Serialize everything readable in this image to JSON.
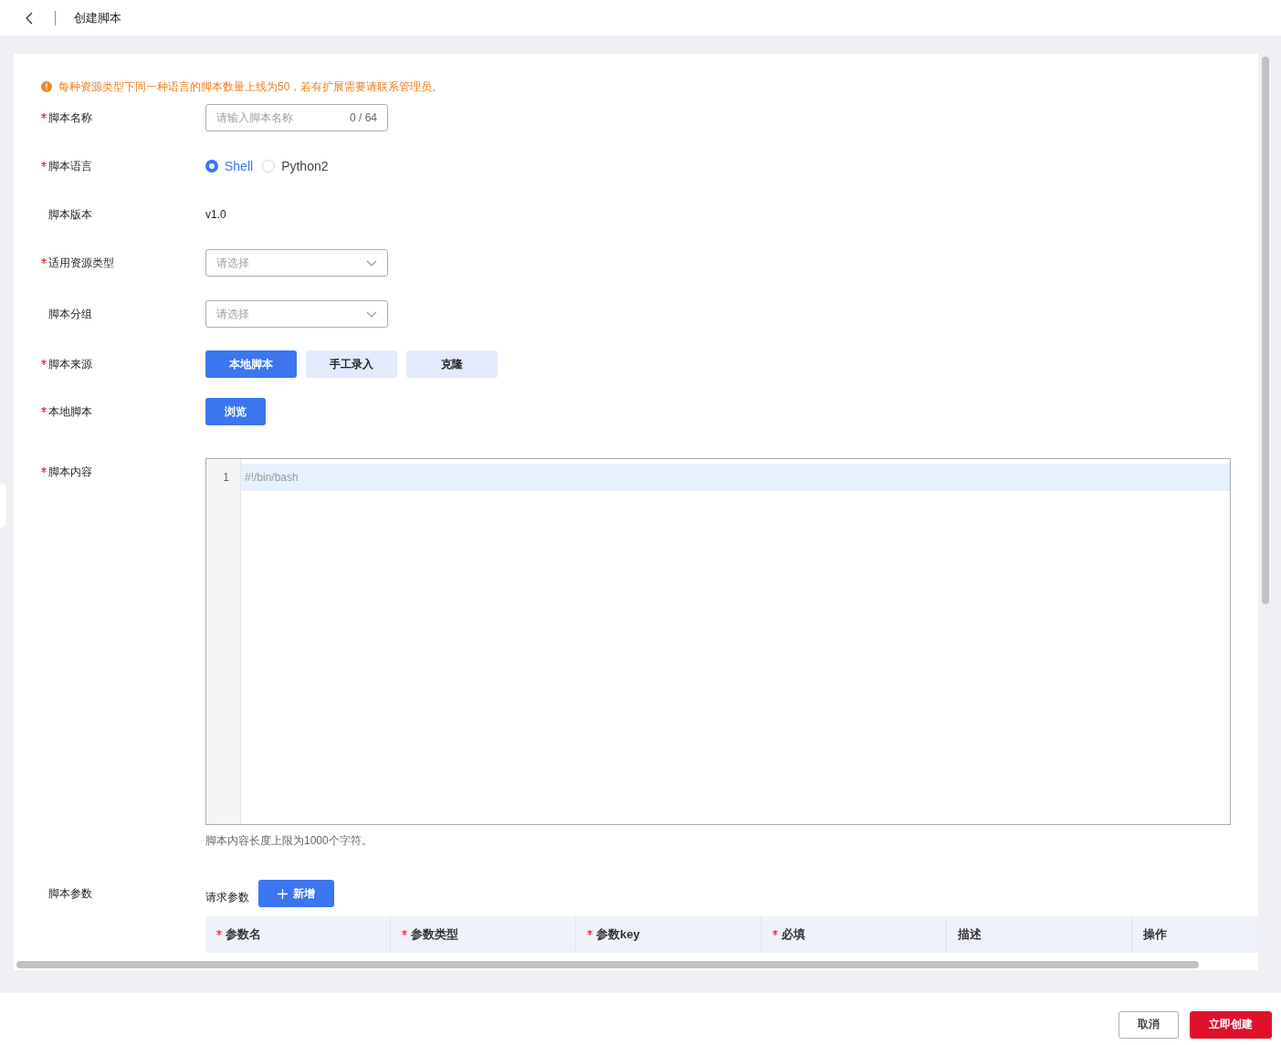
{
  "header": {
    "title": "创建脚本"
  },
  "notice": "每种资源类型下同一种语言的脚本数量上线为50，若有扩展需要请联系管理员。",
  "fields": [
    {
      "kind": "input",
      "label": "脚本名称",
      "required": true,
      "placeholder": "请输入脚本名称",
      "counter": "0 / 64"
    },
    {
      "kind": "radio",
      "label": "脚本语言",
      "required": true,
      "options": [
        {
          "label": "Shell",
          "selected": true
        },
        {
          "label": "Python2",
          "selected": false
        }
      ]
    },
    {
      "kind": "text",
      "label": "脚本版本",
      "required": false,
      "value": "v1.0"
    },
    {
      "kind": "select",
      "label": "适用资源类型",
      "required": true,
      "placeholder": "请选择"
    },
    {
      "kind": "select",
      "label": "脚本分组",
      "required": false,
      "placeholder": "请选择"
    },
    {
      "kind": "segmented",
      "label": "脚本来源",
      "required": true,
      "options": [
        {
          "label": "本地脚本",
          "selected": true
        },
        {
          "label": "手工录入",
          "selected": false
        },
        {
          "label": "克隆",
          "selected": false
        }
      ]
    },
    {
      "kind": "button",
      "label": "本地脚本",
      "required": true,
      "button": "浏览"
    },
    {
      "kind": "editor",
      "label": "脚本内容",
      "required": true,
      "lines": [
        {
          "number": "1",
          "text": "#!/bin/bash",
          "selected": true
        }
      ],
      "hint": "脚本内容长度上限为1000个字符。"
    },
    {
      "kind": "params",
      "label": "脚本参数",
      "required": false,
      "sublabel": "请求参数",
      "add_button": "新增",
      "columns": [
        {
          "label": "参数名",
          "required": true
        },
        {
          "label": "参数类型",
          "required": true
        },
        {
          "label": "参数key",
          "required": true
        },
        {
          "label": "必填",
          "required": true
        },
        {
          "label": "描述",
          "required": false
        },
        {
          "label": "操作",
          "required": false
        }
      ]
    }
  ],
  "footer": {
    "buttons": [
      {
        "label": "取消",
        "kind": "secondary"
      },
      {
        "label": "立即创建",
        "kind": "primary"
      }
    ]
  }
}
